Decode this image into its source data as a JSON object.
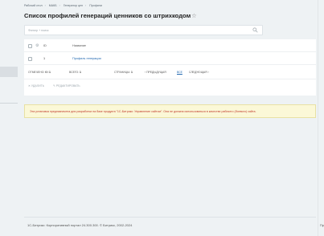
{
  "breadcrumb": [
    "Рабочий стол",
    "МАКБ",
    "Генератор цен",
    "Профили"
  ],
  "page_title": "Список профилей генераций ценников со штрихкодом",
  "search": {
    "placeholder": "Фильтр + поиск"
  },
  "grid": {
    "columns": [
      "ID",
      "Название"
    ],
    "rows": [
      {
        "id": "1",
        "name": "Профиль генерации"
      }
    ]
  },
  "footer": {
    "marked_label": "ОТМЕЧЕНО:",
    "marked_value": "0 / 1",
    "total_label": "ВСЕГО:",
    "total_value": "1",
    "pages_label": "СТРАНИЦЫ:",
    "pages_value": "1",
    "prev": "ПРЕДЫДУЩАЯ",
    "all": "ВСЕ",
    "next": "СЛЕДУЮЩАЯ"
  },
  "actions": {
    "delete": "УДАЛИТЬ",
    "edit": "РЕДАКТИРОВАТЬ"
  },
  "notice": "Эта установка предназначена для разработки на базе продукта \"1С-Битрикс: Управление сайтом\". Она не должна использоваться в качестве рабочего (боевого) сайта.",
  "copyright": "1С-Битрикс: Корпоративный портал 24.300.300. © Битрикс, 2002-2024",
  "corner_text": "Пр",
  "colors": {
    "link": "#2067b0",
    "notice_bg": "#fbf8d7",
    "notice_text": "#c0392b",
    "page_bg": "#eef2f4"
  },
  "icons": {
    "star": "star-icon",
    "search": "search-icon",
    "settings": "gear-icon",
    "delete": "close-icon",
    "edit": "pencil-icon"
  }
}
